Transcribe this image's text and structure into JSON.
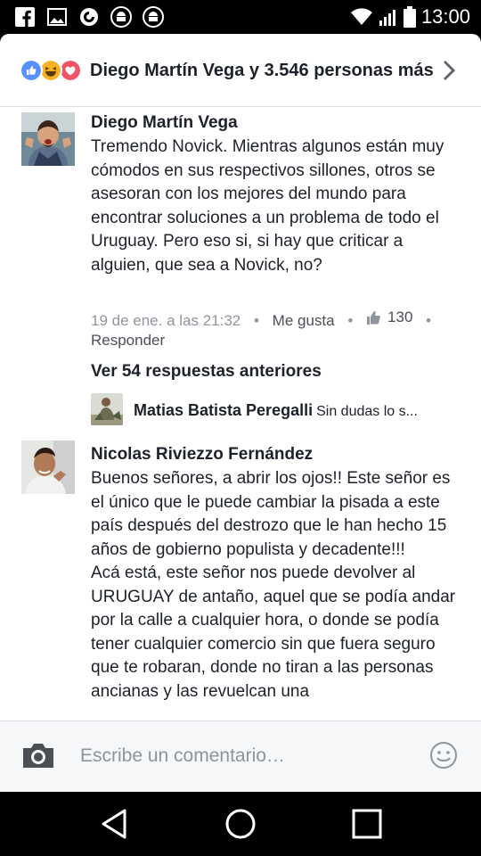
{
  "status_bar": {
    "time": "13:00",
    "left_icons": [
      "facebook-icon",
      "gallery-icon",
      "sync-icon",
      "android-icon",
      "android-icon"
    ],
    "right_icons": [
      "wifi-icon",
      "signal-icon",
      "battery-icon"
    ]
  },
  "reactions": {
    "icons": [
      "like-reaction-icon",
      "haha-reaction-icon",
      "love-reaction-icon"
    ],
    "summary": "Diego Martín Vega y 3.546 personas más"
  },
  "comments": [
    {
      "author": "Diego Martín Vega",
      "text": "Tremendo Novick. Mientras algunos están muy cómodos en sus respectivos sillones, otros se asesoran con los mejores del mundo para encontrar soluciones a un problema de todo el Uruguay. Pero eso si, si hay que criticar a alguien, que sea a Novick, no?",
      "timestamp": "19 de ene. a las 21:32",
      "like_label": "Me gusta",
      "like_count": "130",
      "reply_label": "Responder"
    },
    {
      "author": "Nicolas Riviezzo Fernández",
      "text": "Buenos señores, a abrir los ojos!! Este señor es el único que le puede cambiar la pisada a este país después del destrozo que le han hecho 15 años de gobierno populista y decadente!!!\nAcá está, este señor nos puede devolver al URUGUAY de antaño, aquel que se podía andar por la calle a cualquier hora, o donde se podía tener cualquier comercio sin que fuera seguro que te robaran, donde no tiran a las personas ancianas y las revuelcan una"
    }
  ],
  "replies": {
    "previous_label": "Ver 54 respuestas anteriores",
    "latest": {
      "author": "Matias Batista Peregalli",
      "text": "Sin dudas lo s..."
    }
  },
  "composer": {
    "placeholder": "Escribe un comentario…"
  },
  "nav_bar": {
    "buttons": [
      "back-icon",
      "home-icon",
      "recents-icon"
    ]
  },
  "colors": {
    "facebook_blue": "#5890ff",
    "love_red": "#f25268",
    "haha_yellow": "#f7b125",
    "text_primary": "#1d2129",
    "text_secondary": "#90949c"
  }
}
